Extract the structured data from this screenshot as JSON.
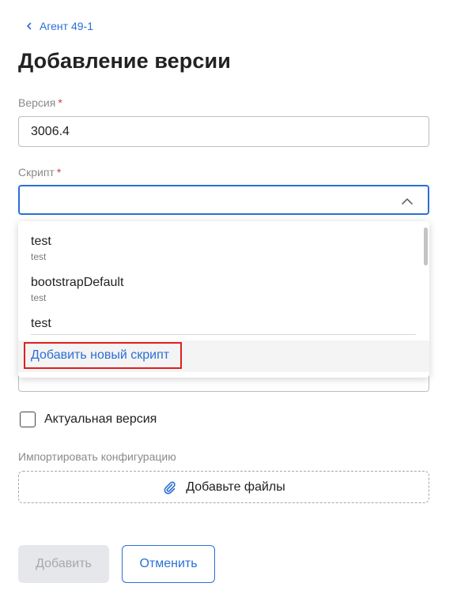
{
  "breadcrumb": {
    "label": "Агент 49-1"
  },
  "page_title": "Добавление версии",
  "version_field": {
    "label": "Версия",
    "required_mark": "*",
    "value": "3006.4"
  },
  "script_field": {
    "label": "Скрипт",
    "required_mark": "*",
    "value": ""
  },
  "dropdown": {
    "items": [
      {
        "title": "test",
        "subtitle": "test"
      },
      {
        "title": "bootstrapDefault",
        "subtitle": "test"
      },
      {
        "title": "test"
      }
    ],
    "add_new_label": "Добавить новый скрипт"
  },
  "actual_version": {
    "label": "Актуальная версия",
    "checked": false
  },
  "import_config": {
    "label": "Импортировать конфигурацию",
    "dropzone_label": "Добавьте файлы"
  },
  "buttons": {
    "add": "Добавить",
    "cancel": "Отменить"
  },
  "colors": {
    "accent": "#2b6fd6",
    "highlight_border": "#e0201c",
    "required": "#d9363e"
  },
  "icons": {
    "back": "chevron-left-icon",
    "dropdown_toggle": "chevron-up-icon",
    "attach": "paperclip-icon"
  }
}
